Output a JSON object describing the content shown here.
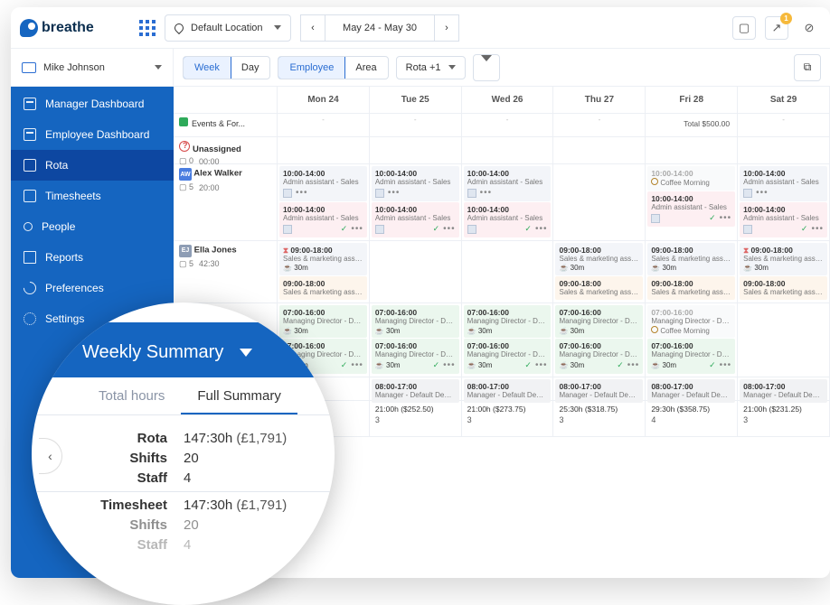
{
  "brand": "breathe",
  "location": {
    "label": "Default Location"
  },
  "dateRange": "May 24 - May 30",
  "notifCount": "1",
  "user": "Mike Johnson",
  "nav": {
    "managerDashboard": "Manager Dashboard",
    "employeeDashboard": "Employee Dashboard",
    "rota": "Rota",
    "timesheets": "Timesheets",
    "people": "People",
    "reports": "Reports",
    "preferences": "Preferences",
    "settings": "Settings"
  },
  "filters": {
    "week": "Week",
    "day": "Day",
    "employee": "Employee",
    "area": "Area",
    "rotaDD": "Rota +1"
  },
  "days": [
    "Mon 24",
    "Tue 25",
    "Wed 26",
    "Thu 27",
    "Fri 28",
    "Sat 29"
  ],
  "rows": {
    "events": {
      "label": "Events & For...",
      "friTotal": "Total $500.00"
    },
    "unassigned": {
      "label": "Unassigned",
      "sub1": "0",
      "sub2": "00:00"
    },
    "alex": {
      "name": "Alex Walker",
      "code": "AW",
      "s1": "5",
      "s2": "20:00",
      "time": "10:00-14:00",
      "role": "Admin assistant - Sales",
      "time2": "10:00-14:00",
      "role2": "Admin assistant - Sales",
      "coffee": "Coffee Morning"
    },
    "ella": {
      "name": "Ella Jones",
      "code": "EJ",
      "s1": "5",
      "s2": "42:30",
      "blockA": {
        "time": "09:00-18:00",
        "role": "Sales & marketing assistant -",
        "break": "30m"
      },
      "blockB": {
        "time": "09:00-18:00",
        "role": "Sales & marketing assistant -"
      }
    },
    "md": {
      "time": "07:00-16:00",
      "role": "Managing Director - Default Dep...",
      "break": "30m",
      "time2": "07:00-16:00",
      "role2": "Managing Director - Default Dep..."
    },
    "mgr": {
      "time": "08:00-17:00",
      "role": "Manager - Default Department"
    }
  },
  "totals": {
    "d0": {
      "h": "21:00h ($252.50)",
      "c": "3"
    },
    "d1": {
      "h": "21:00h ($273.75)",
      "c": "3"
    },
    "d2": {
      "h": "25:30h ($318.75)",
      "c": "3"
    },
    "d3": {
      "h": "29:30h ($358.75)",
      "c": "4"
    },
    "d4": {
      "h": "21:00h ($231.25)",
      "c": "3"
    }
  },
  "lens": {
    "title": "Weekly Summary",
    "tabTotal": "Total hours",
    "tabFull": "Full Summary",
    "rota": {
      "k": "Rota",
      "v": "147:30h",
      "p": "(£1,791)"
    },
    "shifts": {
      "k": "Shifts",
      "v": "20"
    },
    "staff": {
      "k": "Staff",
      "v": "4"
    },
    "ts": {
      "k": "Timesheet",
      "v": "147:30h",
      "p": "(£1,791)"
    },
    "shifts2": {
      "k": "Shifts",
      "v": "20"
    },
    "staff2": {
      "k": "Staff",
      "v": "4"
    }
  }
}
